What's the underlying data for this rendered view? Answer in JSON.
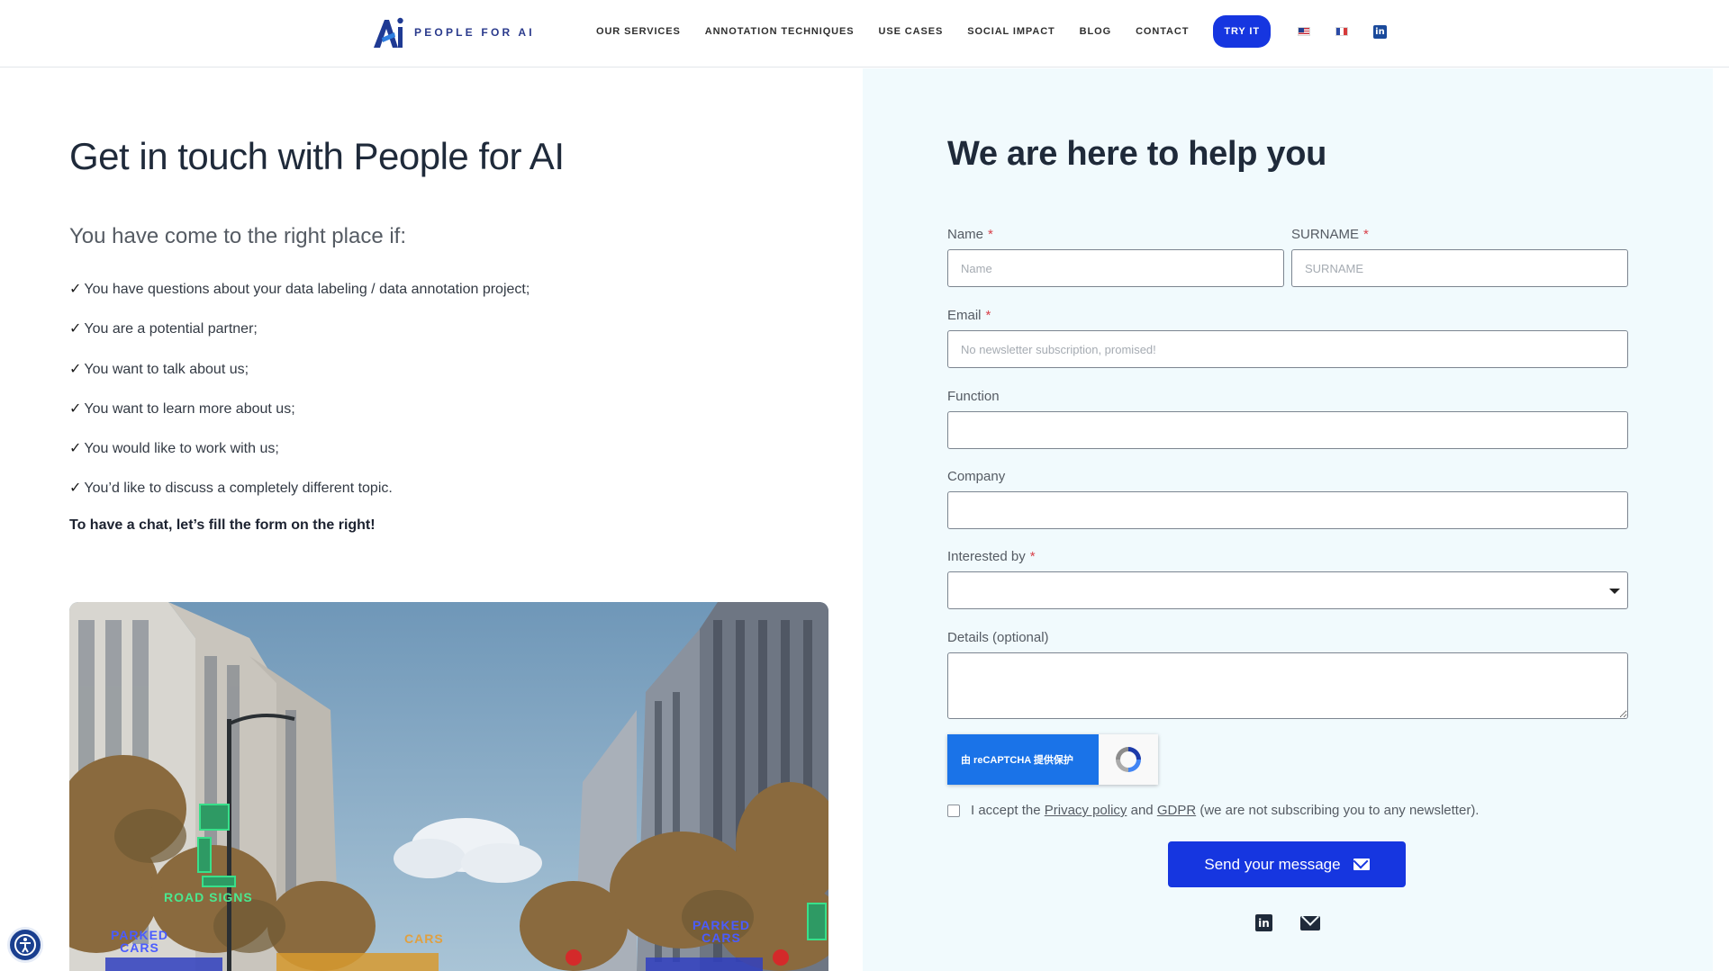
{
  "header": {
    "logo_text": "PEOPLE FOR AI",
    "nav": [
      "OUR SERVICES",
      "ANNOTATION TECHNIQUES",
      "USE CASES",
      "SOCIAL IMPACT",
      "BLOG",
      "CONTACT"
    ],
    "try_label": "TRY IT",
    "linkedin_glyph": "in",
    "icons": [
      "us-flag-icon",
      "fr-flag-icon",
      "linkedin-icon"
    ]
  },
  "left": {
    "title": "Get in touch with People for AI",
    "subtitle": "You have come to the right place if:",
    "tick": "✓",
    "items": [
      "You have questions about your data labeling / data annotation project;",
      "You are a potential partner;",
      "You want to talk about us;",
      "You want to learn more about us;",
      "You would like to work with us;",
      "You’d like to discuss a completely different topic."
    ],
    "cta": "To have a chat, let’s fill the form on the right!",
    "photo_tags": {
      "road_signs": "ROAD SIGNS",
      "parked_left": "PARKED CARS",
      "cars": "CARS",
      "parked_right": "PARKED CARS"
    }
  },
  "form": {
    "title": "We are here to help you",
    "required_mark": "*",
    "name_label": "Name",
    "name_placeholder": "Name",
    "surname_label": "SURNAME",
    "surname_placeholder": "SURNAME",
    "email_label": "Email",
    "email_placeholder": "No newsletter subscription, promised!",
    "function_label": "Function",
    "company_label": "Company",
    "interested_label": "Interested by",
    "details_label": "Details (optional)",
    "recaptcha_text": "由 reCAPTCHA 提供保护",
    "consent_prefix": "I accept the",
    "privacy_link": "Privacy policy",
    "consent_and": "and",
    "gdpr_link": "GDPR",
    "consent_suffix": "(we are not subscribing you to any newsletter).",
    "send_label": "Send your message",
    "footer_linkedin_glyph": "in"
  },
  "colors": {
    "accent": "#1636e0",
    "panel_bg": "#f1fafd",
    "required": "#d8414a"
  }
}
